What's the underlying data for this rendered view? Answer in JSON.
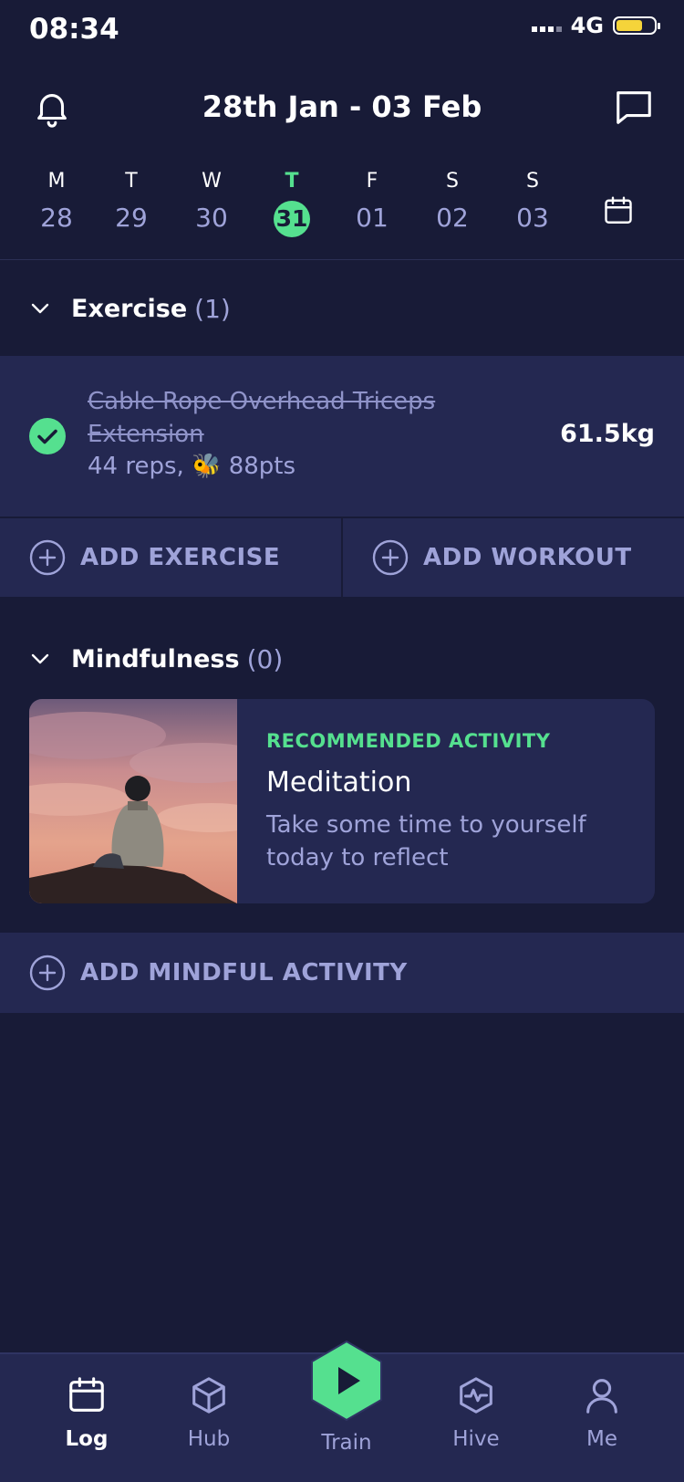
{
  "status": {
    "time": "08:34",
    "network": "4G",
    "battery_level": 0.7
  },
  "header": {
    "title": "28th Jan - 03 Feb",
    "left_icon": "bell-icon",
    "right_icon": "chat-icon"
  },
  "week": {
    "days": [
      {
        "letter": "M",
        "num": "28"
      },
      {
        "letter": "T",
        "num": "29"
      },
      {
        "letter": "W",
        "num": "30"
      },
      {
        "letter": "T",
        "num": "31",
        "active": true
      },
      {
        "letter": "F",
        "num": "01"
      },
      {
        "letter": "S",
        "num": "02"
      },
      {
        "letter": "S",
        "num": "03"
      }
    ],
    "calendar_icon": "calendar-icon"
  },
  "exercise": {
    "title": "Exercise",
    "count": "(1)",
    "item": {
      "name": "Cable Rope Overhead Triceps Extension",
      "meta_reps": "44 reps,",
      "meta_emoji": "🐝",
      "meta_pts": "88pts",
      "weight": "61.5kg",
      "completed": true
    },
    "add_exercise_label": "ADD EXERCISE",
    "add_workout_label": "ADD WORKOUT"
  },
  "mindfulness": {
    "title": "Mindfulness",
    "count": "(0)",
    "recommendation": {
      "tag": "RECOMMENDED ACTIVITY",
      "title": "Meditation",
      "description": "Take some time to yourself today to reflect"
    },
    "add_label": "ADD MINDFUL ACTIVITY"
  },
  "tabbar": {
    "tabs": [
      {
        "label": "Log",
        "icon": "calendar-icon",
        "active": true
      },
      {
        "label": "Hub",
        "icon": "cube-icon"
      },
      {
        "label": "Train",
        "icon": "play-icon"
      },
      {
        "label": "Hive",
        "icon": "activity-hexagon-icon"
      },
      {
        "label": "Me",
        "icon": "user-icon"
      }
    ]
  },
  "colors": {
    "background": "#181b37",
    "card": "#242851",
    "accent_green": "#55e08f",
    "muted_text": "#9fa3d9"
  }
}
